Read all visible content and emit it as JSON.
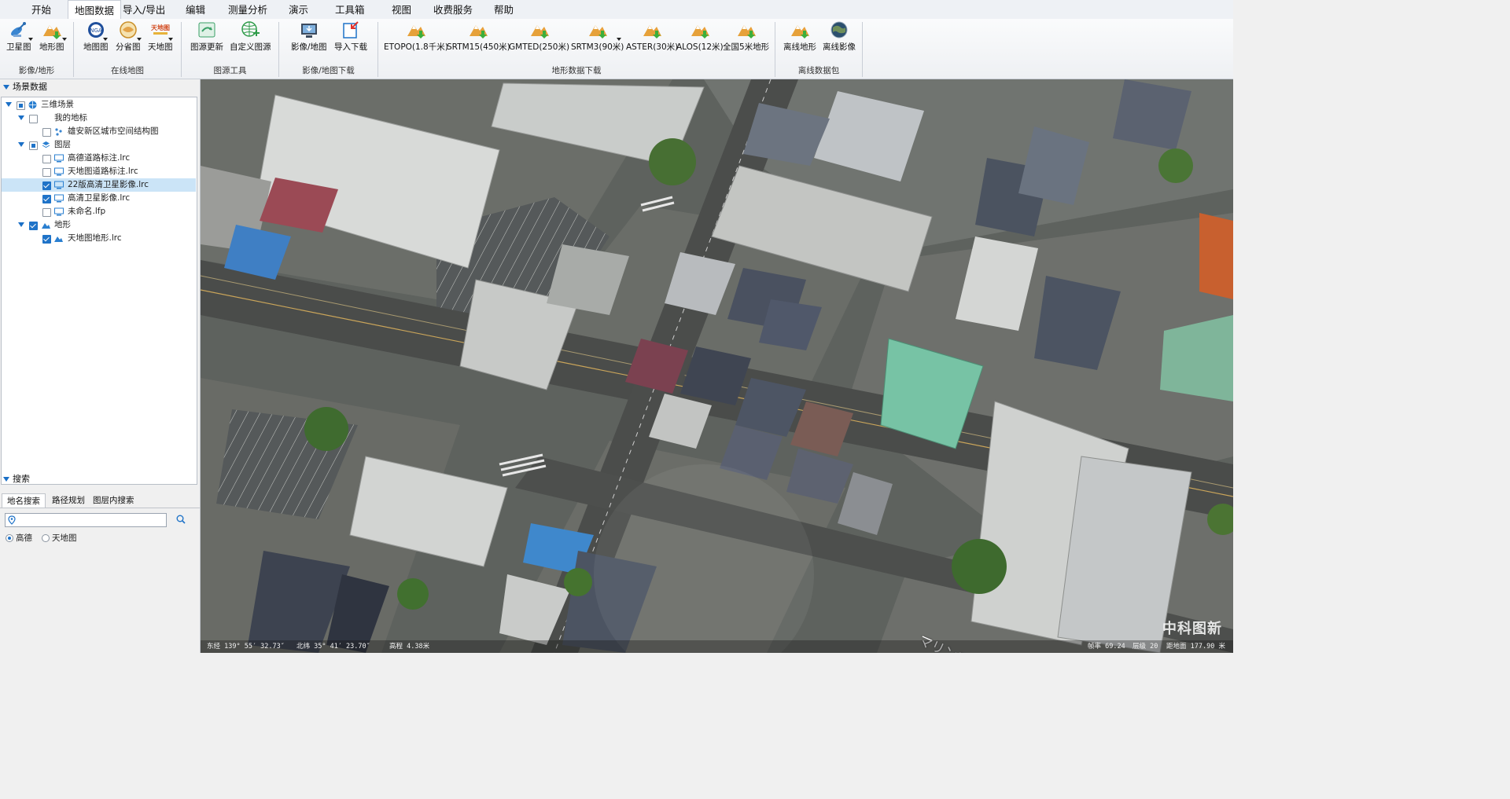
{
  "menu": {
    "items": [
      "开始",
      "地图数据",
      "导入/导出",
      "编辑",
      "测量分析",
      "演示",
      "工具箱",
      "视图",
      "收费服务",
      "帮助"
    ],
    "active_index": 1
  },
  "ribbon": {
    "buttons": [
      {
        "label": "卫星图",
        "icon": "satellite-icon"
      },
      {
        "label": "地形图",
        "icon": "terrain-icon"
      },
      {
        "label": "地图图",
        "icon": "nga-map-icon"
      },
      {
        "label": "分省图",
        "icon": "province-map-icon"
      },
      {
        "label": "天地图",
        "icon": "tianditu-icon"
      },
      {
        "label": "图源更新",
        "icon": "source-update-icon"
      },
      {
        "label": "自定义图源",
        "icon": "custom-source-icon"
      },
      {
        "label": "影像/地图",
        "icon": "image-map-download-icon"
      },
      {
        "label": "导入下载",
        "icon": "import-download-icon"
      },
      {
        "label": "ETOPO(1.8千米)",
        "icon": "terrain-download-icon"
      },
      {
        "label": "SRTM15(450米)",
        "icon": "terrain-download-icon"
      },
      {
        "label": "GMTED(250米)",
        "icon": "terrain-download-icon"
      },
      {
        "label": "SRTM3(90米)",
        "icon": "terrain-download-icon"
      },
      {
        "label": "ASTER(30米)",
        "icon": "terrain-download-icon"
      },
      {
        "label": "ALOS(12米)",
        "icon": "terrain-download-icon"
      },
      {
        "label": "全国5米地形",
        "icon": "terrain-download-icon"
      },
      {
        "label": "离线地形",
        "icon": "offline-terrain-icon"
      },
      {
        "label": "离线影像",
        "icon": "offline-imagery-icon"
      }
    ],
    "groups": [
      "影像/地形",
      "在线地图",
      "图源工具",
      "影像/地图下载",
      "地形数据下载",
      "离线数据包"
    ]
  },
  "scene_panel": {
    "title": "场景数据",
    "tree": [
      {
        "label": "三维场景",
        "checked": "partial",
        "icon": "globe-icon",
        "expanded": true
      },
      {
        "label": "我的地标",
        "checked": "off",
        "icon": "",
        "expanded": true
      },
      {
        "label": "雄安新区城市空间结构图",
        "checked": "off",
        "icon": "placemark-icon"
      },
      {
        "label": "图层",
        "checked": "partial",
        "icon": "layers-icon",
        "expanded": true
      },
      {
        "label": "高德道路标注.lrc",
        "checked": "off",
        "icon": "monitor-icon"
      },
      {
        "label": "天地图道路标注.lrc",
        "checked": "off",
        "icon": "monitor-icon"
      },
      {
        "label": "22版高清卫星影像.lrc",
        "checked": "on",
        "icon": "monitor-icon",
        "selected": true
      },
      {
        "label": "高清卫星影像.lrc",
        "checked": "on",
        "icon": "monitor-icon"
      },
      {
        "label": "未命名.lfp",
        "checked": "off",
        "icon": "monitor-icon"
      },
      {
        "label": "地形",
        "checked": "on",
        "icon": "terrain-layer-icon",
        "expanded": true
      },
      {
        "label": "天地图地形.lrc",
        "checked": "on",
        "icon": "terrain-layer-icon"
      }
    ]
  },
  "search_panel": {
    "title": "搜索",
    "tabs": [
      "地名搜索",
      "路径规划",
      "图层内搜索"
    ],
    "active_tab": 0,
    "input_value": "",
    "providers": [
      "高德",
      "天地图"
    ],
    "selected_provider": 0
  },
  "map": {
    "road_label": "マリンロード",
    "watermark": "中科图新",
    "status_left": [
      "东经 139° 55′ 32.73″",
      "北纬 35° 41′ 23.70″",
      "高程 4.38米"
    ],
    "status_right": [
      "帧率 69.24",
      "层级 20",
      "距地面 177.90 米"
    ]
  },
  "colors": {
    "accent": "#1f73c8",
    "selection": "#cbe4f7",
    "ribbon_bg": "#eef0f3"
  }
}
